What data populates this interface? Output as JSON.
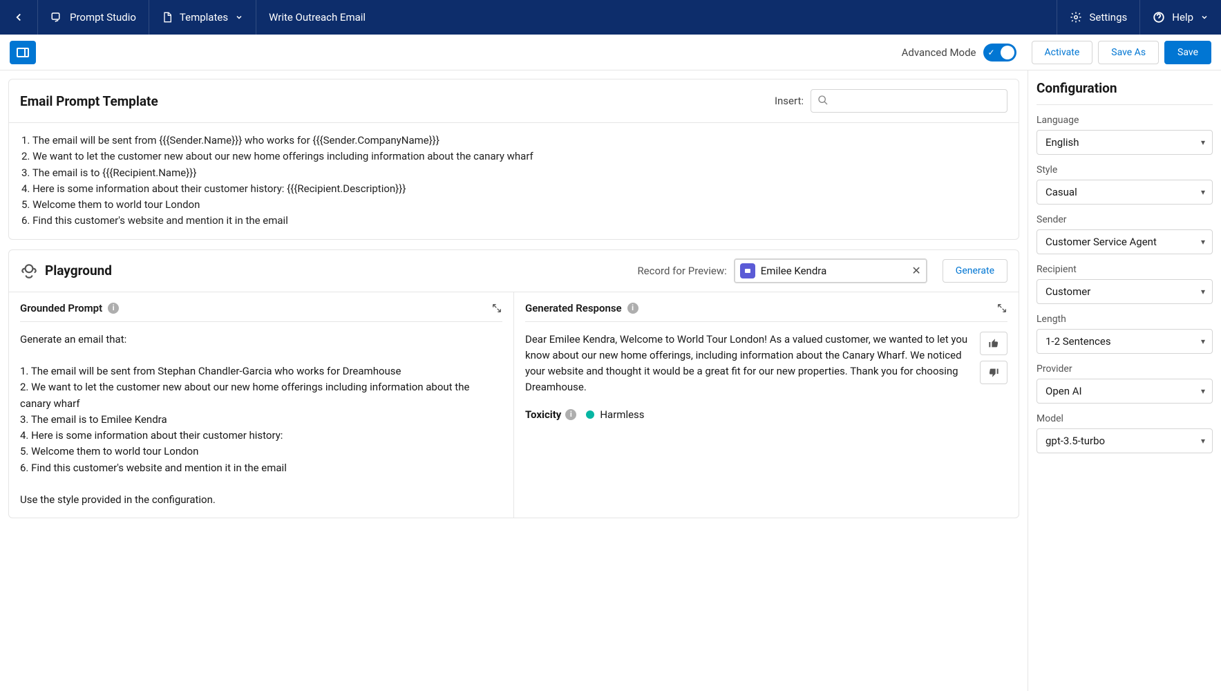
{
  "header": {
    "app_name": "Prompt Studio",
    "templates_label": "Templates",
    "breadcrumb": "Write Outreach Email",
    "settings_label": "Settings",
    "help_label": "Help"
  },
  "subheader": {
    "advanced_mode_label": "Advanced Mode",
    "activate_label": "Activate",
    "save_as_label": "Save As",
    "save_label": "Save"
  },
  "template_card": {
    "title": "Email Prompt Template",
    "insert_label": "Insert:",
    "search_placeholder": "",
    "body": "1. The email will be sent from {{{Sender.Name}}} who works for {{{Sender.CompanyName}}}\n2. We want to let the customer new about our new home offerings including information about the canary wharf\n3. The email is to {{{Recipient.Name}}}\n4. Here is some information about their customer history: {{{Recipient.Description}}}\n5. Welcome them to world tour London\n6. Find this customer's website and mention it in the email"
  },
  "playground": {
    "title": "Playground",
    "record_label": "Record for Preview:",
    "record_value": "Emilee Kendra",
    "generate_label": "Generate",
    "grounded": {
      "title": "Grounded Prompt",
      "body": "Generate an email that:\n\n1. The email will be sent from Stephan Chandler-Garcia who works for Dreamhouse\n2. We want to let the customer new about our new home offerings including information about the canary wharf\n3. The email is to Emilee Kendra\n4. Here is some information about their customer history:\n5. Welcome them to world tour London\n6. Find this customer's website and mention it in the email\n\nUse the style provided in the configuration."
    },
    "response": {
      "title": "Generated Response",
      "body": "Dear Emilee Kendra, Welcome to World Tour London! As a valued customer, we wanted to let you know about our new home offerings, including information about the Canary Wharf. We noticed your website and thought it would be a great fit for our new properties. Thank you for choosing Dreamhouse.",
      "toxicity_label": "Toxicity",
      "toxicity_value": "Harmless"
    }
  },
  "config": {
    "title": "Configuration",
    "language_label": "Language",
    "language_value": "English",
    "style_label": "Style",
    "style_value": "Casual",
    "sender_label": "Sender",
    "sender_value": "Customer Service Agent",
    "recipient_label": "Recipient",
    "recipient_value": "Customer",
    "length_label": "Length",
    "length_value": "1-2 Sentences",
    "provider_label": "Provider",
    "provider_value": "Open AI",
    "model_label": "Model",
    "model_value": "gpt-3.5-turbo"
  }
}
